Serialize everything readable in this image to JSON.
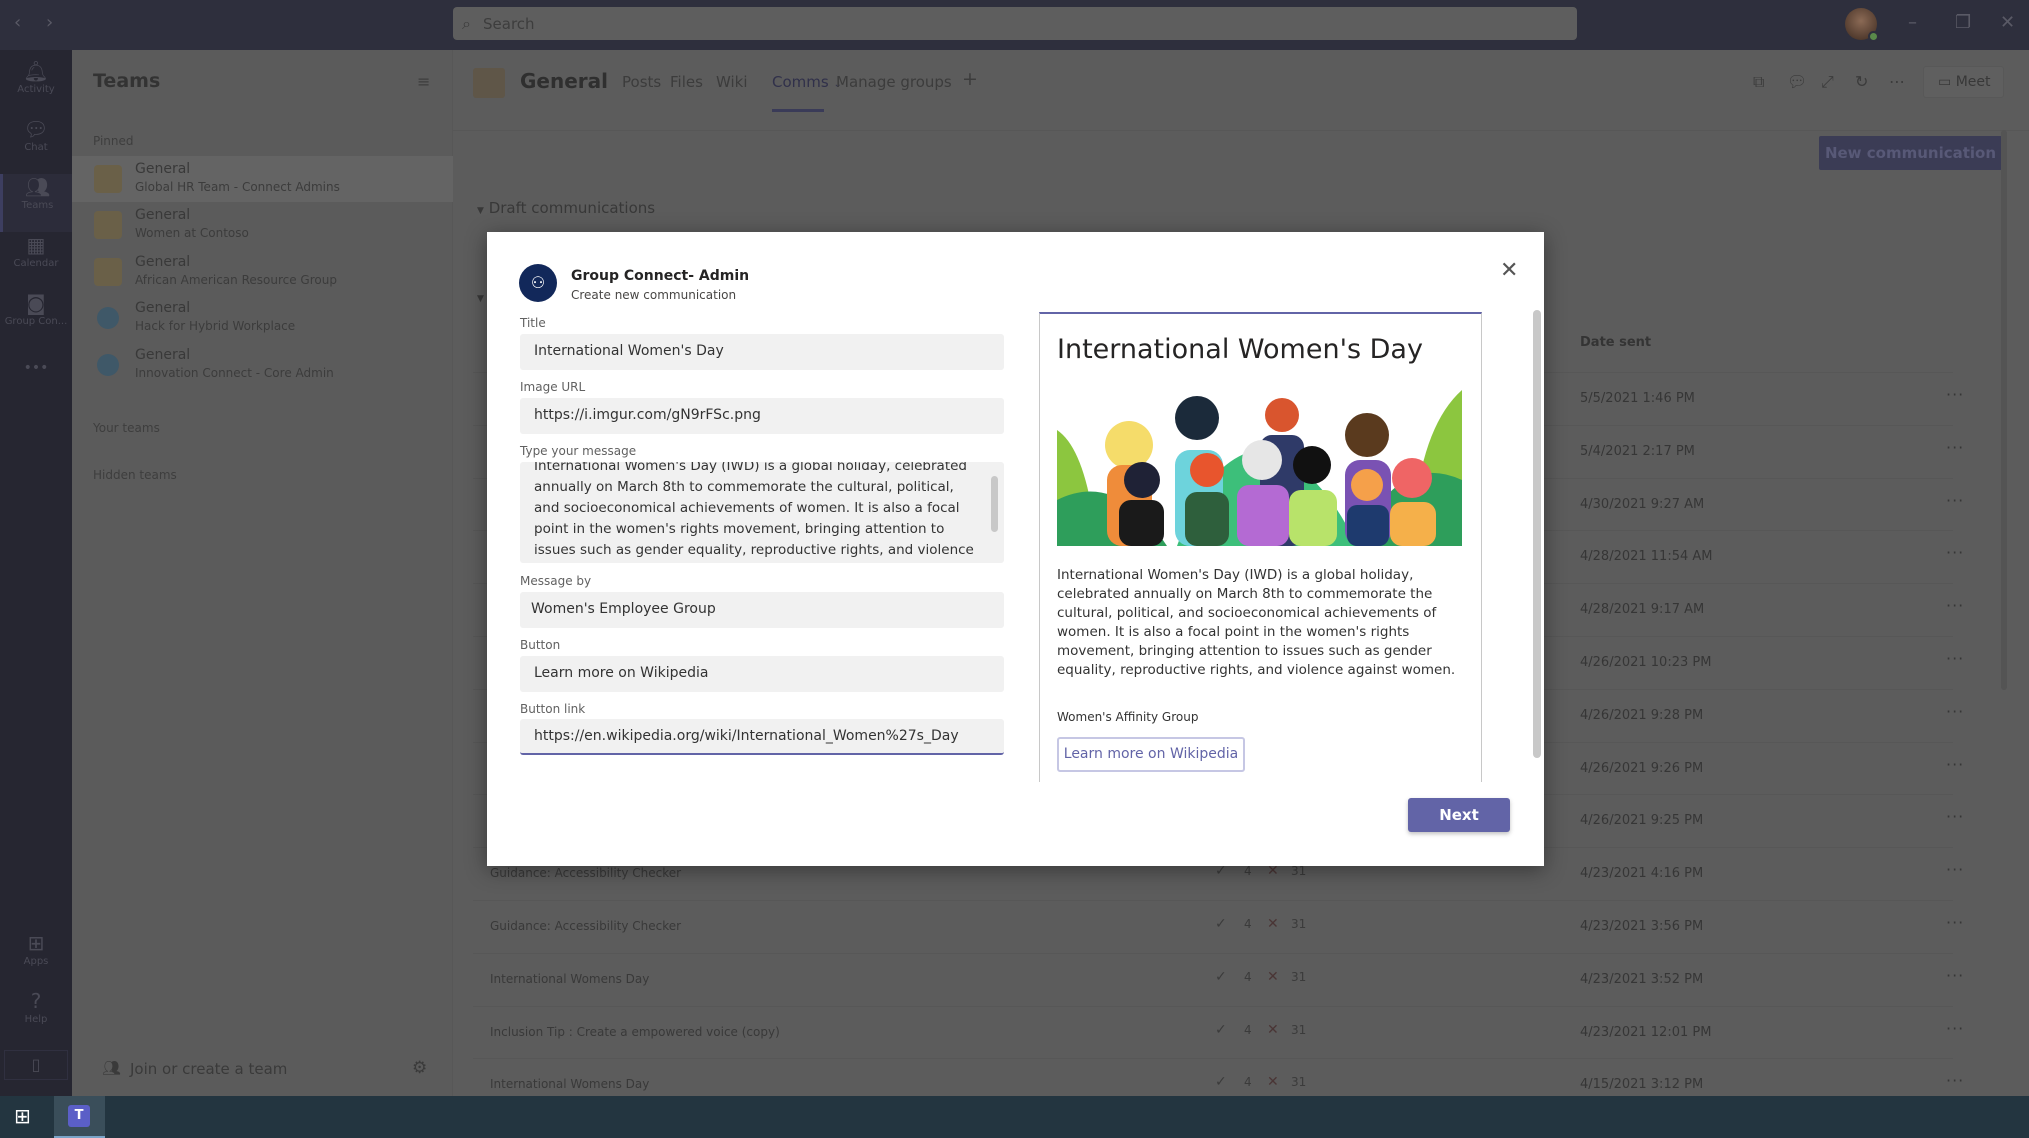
{
  "titlebar": {
    "search_placeholder": "Search"
  },
  "rail": {
    "items": [
      {
        "label": "Activity",
        "icon": "bell-icon"
      },
      {
        "label": "Chat",
        "icon": "chat-icon"
      },
      {
        "label": "Teams",
        "icon": "teams-icon"
      },
      {
        "label": "Calendar",
        "icon": "calendar-icon"
      },
      {
        "label": "Group Con...",
        "icon": "group-connect-icon"
      }
    ],
    "more": "•••",
    "apps": "Apps",
    "help": "Help"
  },
  "pane": {
    "title": "Teams",
    "pinned_label": "Pinned",
    "pinned": [
      {
        "channel": "General",
        "team": "Global HR Team - Connect Admins"
      },
      {
        "channel": "General",
        "team": "Women at Contoso"
      },
      {
        "channel": "General",
        "team": "African American Resource Group"
      },
      {
        "channel": "General",
        "team": "Hack for Hybrid Workplace"
      },
      {
        "channel": "General",
        "team": "Innovation Connect - Core Admin"
      }
    ],
    "your_teams": "Your teams",
    "hidden_teams": "Hidden teams",
    "join": "Join or create a team"
  },
  "header": {
    "channel": "General",
    "tabs": [
      "Posts",
      "Files",
      "Wiki",
      "Comms",
      "Manage groups"
    ],
    "active_tab": "Comms",
    "meet": "Meet"
  },
  "main": {
    "new_communication": "New communication",
    "drafts": "Draft communications",
    "date_header": "Date sent",
    "rows": [
      {
        "title": "",
        "ok": "",
        "fail": "",
        "date": "5/5/2021 1:46 PM"
      },
      {
        "title": "",
        "ok": "",
        "fail": "",
        "date": "5/4/2021 2:17 PM"
      },
      {
        "title": "",
        "ok": "",
        "fail": "",
        "date": "4/30/2021 9:27 AM"
      },
      {
        "title": "",
        "ok": "",
        "fail": "",
        "date": "4/28/2021 11:54 AM"
      },
      {
        "title": "",
        "ok": "",
        "fail": "",
        "date": "4/28/2021 9:17 AM"
      },
      {
        "title": "",
        "ok": "",
        "fail": "",
        "date": "4/26/2021 10:23 PM"
      },
      {
        "title": "",
        "ok": "",
        "fail": "",
        "date": "4/26/2021 9:28 PM"
      },
      {
        "title": "",
        "ok": "",
        "fail": "",
        "date": "4/26/2021 9:26 PM"
      },
      {
        "title": "",
        "ok": "",
        "fail": "",
        "date": "4/26/2021 9:25 PM"
      },
      {
        "title": "Guidance: Accessibility Checker",
        "ok": "4",
        "fail": "31",
        "date": "4/23/2021 4:16 PM"
      },
      {
        "title": "Guidance: Accessibility Checker",
        "ok": "4",
        "fail": "31",
        "date": "4/23/2021 3:56 PM"
      },
      {
        "title": "International Womens Day",
        "ok": "4",
        "fail": "31",
        "date": "4/23/2021 3:52 PM"
      },
      {
        "title": "Inclusion Tip : Create a empowered voice (copy)",
        "ok": "4",
        "fail": "31",
        "date": "4/23/2021 12:01 PM"
      },
      {
        "title": "International Womens Day",
        "ok": "4",
        "fail": "31",
        "date": "4/15/2021 3:12 PM"
      }
    ]
  },
  "modal": {
    "app_name": "Group Connect- Admin",
    "subtitle": "Create new communication",
    "fields": {
      "title_label": "Title",
      "title_value": "International Women's Day",
      "image_label": "Image URL",
      "image_value": "https://i.imgur.com/gN9rFSc.png",
      "message_label": "Type your message",
      "message_value": "International Women's Day (IWD) is a global holiday, celebrated annually on March 8th to commemorate the cultural, political, and socioeconomical achievements of women.  It is also a focal point in the  women's rights movement, bringing attention to issues such as gender equality, reproductive rights, and violence against women.",
      "by_label": "Message by",
      "by_value": "Women's Employee Group",
      "button_label": "Button",
      "button_value": "Learn more on Wikipedia",
      "link_label": "Button link",
      "link_value": "https://en.wikipedia.org/wiki/International_Women%27s_Day"
    },
    "preview": {
      "title": "International Women's Day",
      "body": "International Women's Day (IWD) is a global holiday, celebrated annually on March 8th to commemorate the cultural, political, and socioeconomical achievements of women. It is also a focal point in the women's rights movement, bringing attention to issues such as gender equality, reproductive rights, and violence against women.",
      "by": "Women's Affinity Group",
      "button": "Learn more on Wikipedia"
    },
    "next": "Next"
  },
  "colors": {
    "accent": "#6264a7",
    "app_avatar": "#12285a"
  }
}
